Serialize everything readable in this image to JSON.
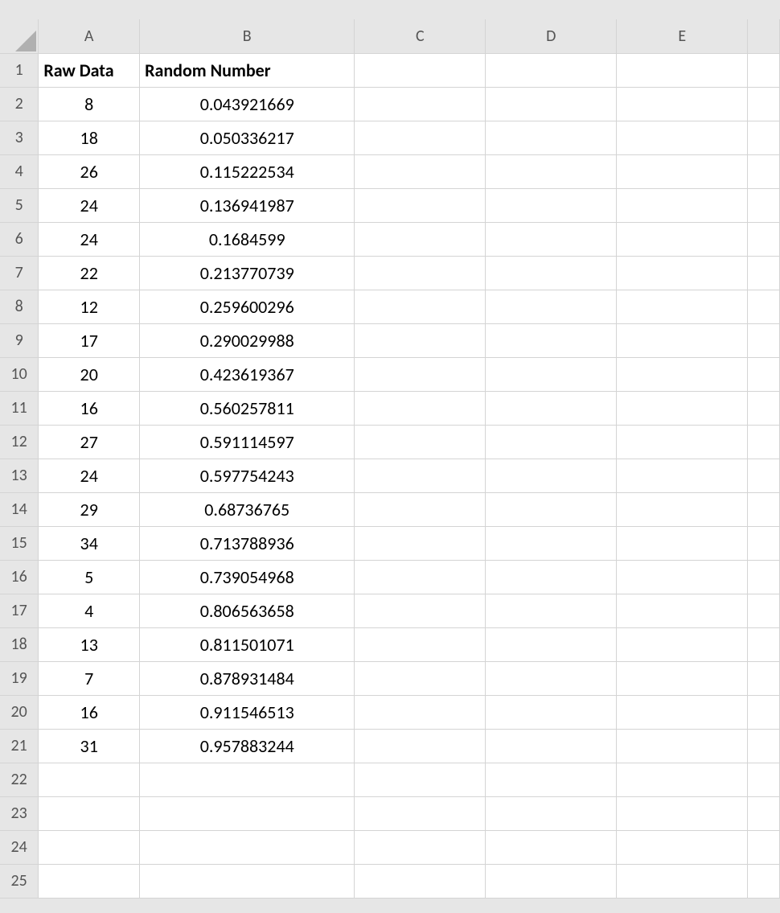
{
  "columns": [
    "A",
    "B",
    "C",
    "D",
    "E",
    ""
  ],
  "rowNumbers": [
    "",
    "1",
    "2",
    "3",
    "4",
    "5",
    "6",
    "7",
    "8",
    "9",
    "10",
    "11",
    "12",
    "13",
    "14",
    "15",
    "16",
    "17",
    "18",
    "19",
    "20",
    "21",
    "22",
    "23",
    "24",
    "25"
  ],
  "headerRow": {
    "A": "Raw Data",
    "B": "Random Number"
  },
  "data": [
    {
      "A": "8",
      "B": "0.043921669"
    },
    {
      "A": "18",
      "B": "0.050336217"
    },
    {
      "A": "26",
      "B": "0.115222534"
    },
    {
      "A": "24",
      "B": "0.136941987"
    },
    {
      "A": "24",
      "B": "0.1684599"
    },
    {
      "A": "22",
      "B": "0.213770739"
    },
    {
      "A": "12",
      "B": "0.259600296"
    },
    {
      "A": "17",
      "B": "0.290029988"
    },
    {
      "A": "20",
      "B": "0.423619367"
    },
    {
      "A": "16",
      "B": "0.560257811"
    },
    {
      "A": "27",
      "B": "0.591114597"
    },
    {
      "A": "24",
      "B": "0.597754243"
    },
    {
      "A": "29",
      "B": "0.68736765"
    },
    {
      "A": "34",
      "B": "0.713788936"
    },
    {
      "A": "5",
      "B": "0.739054968"
    },
    {
      "A": "4",
      "B": "0.806563658"
    },
    {
      "A": "13",
      "B": "0.811501071"
    },
    {
      "A": "7",
      "B": "0.878931484"
    },
    {
      "A": "16",
      "B": "0.911546513"
    },
    {
      "A": "31",
      "B": "0.957883244"
    }
  ],
  "emptyRows": 4
}
